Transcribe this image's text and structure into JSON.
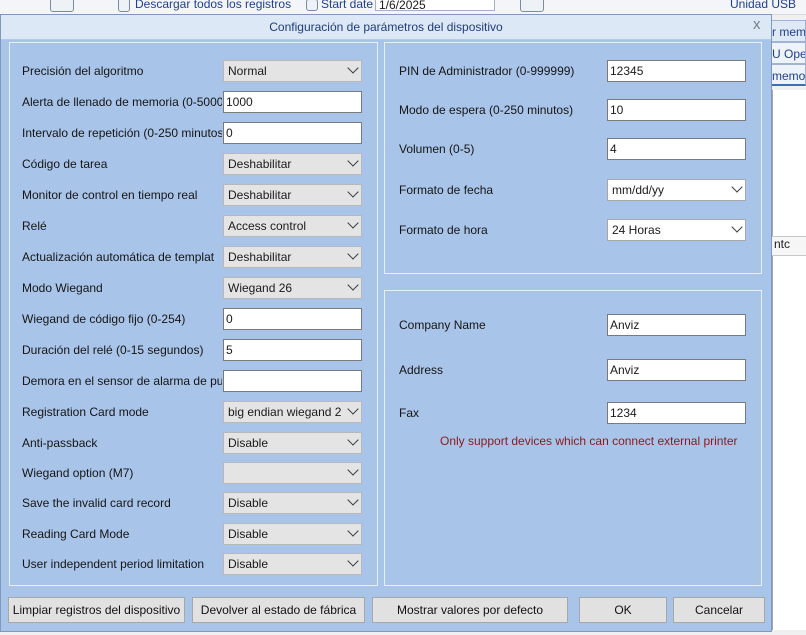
{
  "background": {
    "toolbar_text": "Descargar todos los registros",
    "start_date_label": "Start date",
    "start_date_value": "1/6/2025",
    "usb_label": "Unidad USB",
    "tab_fragment_1": "r mem",
    "tab_fragment_2": "U Ope",
    "tab_fragment_3": "memo",
    "header_fragment": "ntc"
  },
  "dialog": {
    "title": "Configuración de parámetros del dispositivo",
    "close": "x",
    "left_fields": [
      {
        "label": "Precisión del algoritmo",
        "type": "combo",
        "value": "Normal"
      },
      {
        "label": "Alerta de llenado de memoria (0-5000)",
        "type": "input",
        "value": "1000"
      },
      {
        "label": "Intervalo de repetición (0-250 minutos)",
        "type": "input",
        "value": "0"
      },
      {
        "label": "Código de tarea",
        "type": "combo",
        "value": "Deshabilitar"
      },
      {
        "label": "Monitor de control en tiempo real",
        "type": "combo",
        "value": "Deshabilitar"
      },
      {
        "label": "Relé",
        "type": "combo",
        "value": "Access control"
      },
      {
        "label": "Actualización automática de templat",
        "type": "combo",
        "value": "Deshabilitar"
      },
      {
        "label": "Modo Wiegand",
        "type": "combo",
        "value": "Wiegand 26"
      },
      {
        "label": "Wiegand de código fijo (0-254)",
        "type": "input",
        "value": "0"
      },
      {
        "label": "Duración del relé (0-15 segundos)",
        "type": "input",
        "value": "5"
      },
      {
        "label": "Demora en el sensor de alarma de pu",
        "type": "input",
        "value": ""
      },
      {
        "label": "Registration Card mode",
        "type": "combo",
        "value": "big endian wiegand 26"
      },
      {
        "label": "Anti-passback",
        "type": "combo",
        "value": "Disable"
      },
      {
        "label": "Wiegand option (M7)",
        "type": "combo",
        "value": ""
      },
      {
        "label": "Save the invalid card record",
        "type": "combo",
        "value": "Disable"
      },
      {
        "label": "Reading Card Mode",
        "type": "combo",
        "value": "Disable"
      },
      {
        "label": "User independent period limitation",
        "type": "combo",
        "value": "Disable"
      }
    ],
    "right_top_fields": [
      {
        "label": "PIN de Administrador (0-999999)",
        "type": "input",
        "value": "12345"
      },
      {
        "label": "Modo de espera (0-250 minutos)",
        "type": "input",
        "value": "10"
      },
      {
        "label": "Volumen (0-5)",
        "type": "input",
        "value": "4"
      },
      {
        "label": "Formato de fecha",
        "type": "combo",
        "value": "mm/dd/yy"
      },
      {
        "label": "Formato de hora",
        "type": "combo",
        "value": "24 Horas"
      }
    ],
    "right_bottom_fields": [
      {
        "label": "Company Name",
        "type": "input",
        "value": "Anviz"
      },
      {
        "label": "Address",
        "type": "input",
        "value": "Anviz"
      },
      {
        "label": "Fax",
        "type": "input",
        "value": "1234"
      }
    ],
    "printer_note": "Only support devices which can connect external printer",
    "buttons": {
      "clear_records": "Limpiar registros del dispositivo",
      "factory_reset": "Devolver al estado de fábrica",
      "show_defaults": "Mostrar valores por defecto",
      "ok": "OK",
      "cancel": "Cancelar"
    }
  }
}
